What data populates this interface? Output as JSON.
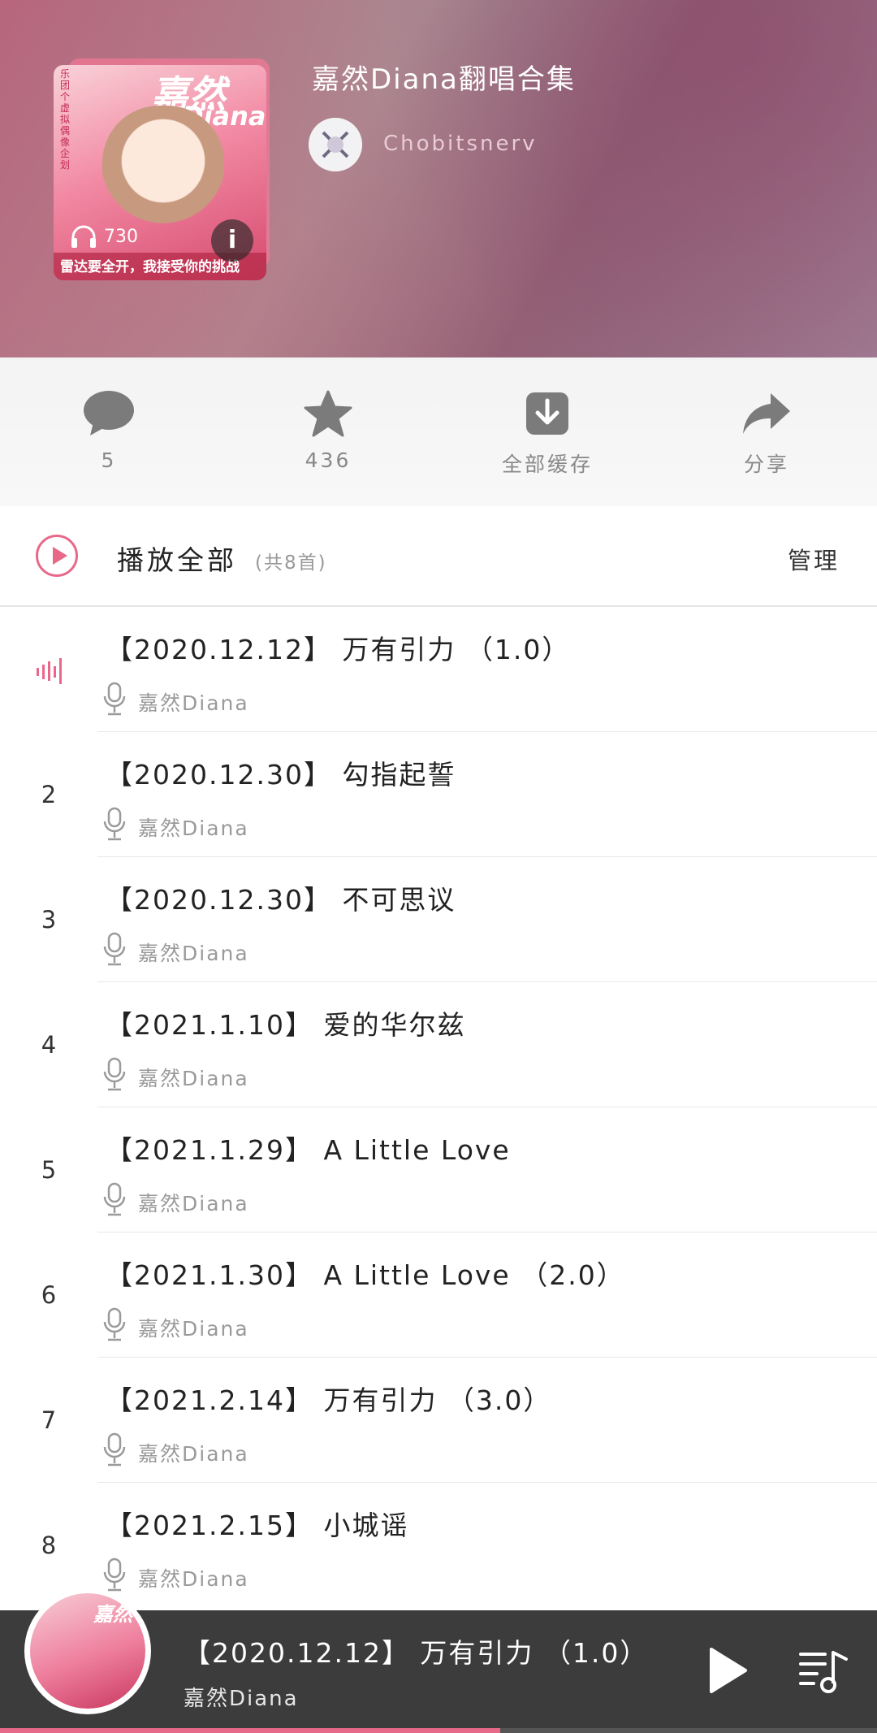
{
  "playlist": {
    "title": "嘉然Diana翻唱合集",
    "creator": "Chobitsnerv",
    "play_count": "730",
    "cover": {
      "side_text": "乐团个虚拟偶像企划",
      "brand": "嘉然",
      "brand_en": "Diana",
      "slogan": "雷达要全开，我接受你的挑战"
    }
  },
  "actions": [
    {
      "icon": "comment-icon",
      "label": "5"
    },
    {
      "icon": "star-icon",
      "label": "436"
    },
    {
      "icon": "download-icon",
      "label": "全部缓存"
    },
    {
      "icon": "share-icon",
      "label": "分享"
    }
  ],
  "play_all": {
    "label": "播放全部",
    "count": "(共8首)",
    "manage": "管理"
  },
  "songs": [
    {
      "index": "",
      "playing": true,
      "title": "【2020.12.12】 万有引力 （1.0）",
      "artist": "嘉然Diana"
    },
    {
      "index": "2",
      "title": "【2020.12.30】 勾指起誓",
      "artist": "嘉然Diana"
    },
    {
      "index": "3",
      "title": "【2020.12.30】 不可思议",
      "artist": "嘉然Diana"
    },
    {
      "index": "4",
      "title": "【2021.1.10】 爱的华尔兹",
      "artist": "嘉然Diana"
    },
    {
      "index": "5",
      "title": "【2021.1.29】 A Little Love",
      "artist": "嘉然Diana"
    },
    {
      "index": "6",
      "title": "【2021.1.30】 A Little Love （2.0）",
      "artist": "嘉然Diana"
    },
    {
      "index": "7",
      "title": "【2021.2.14】 万有引力 （3.0）",
      "artist": "嘉然Diana"
    },
    {
      "index": "8",
      "title": "【2021.2.15】 小城谣",
      "artist": "嘉然Diana"
    }
  ],
  "player": {
    "title": "【2020.12.12】 万有引力 （1.0）",
    "artist": "嘉然Diana",
    "disc_brand": "嘉然",
    "progress": 0.57
  },
  "colors": {
    "accent": "#e8688a",
    "player_bg": "#3c3c3c"
  }
}
